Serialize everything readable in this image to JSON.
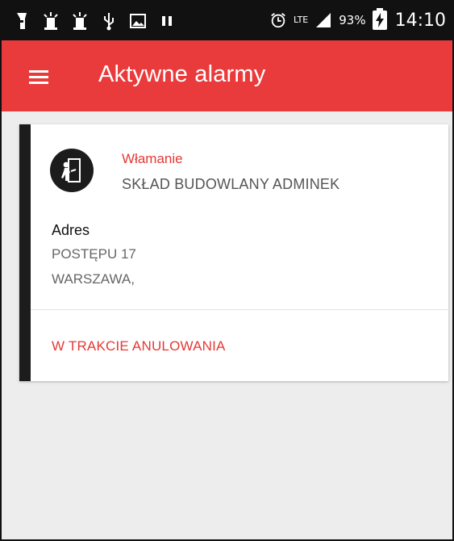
{
  "status_bar": {
    "battery_percent": "93%",
    "network": "LTE",
    "time": "14:10",
    "icons_left": [
      "flashlight-icon",
      "beacon-icon",
      "beacon-icon",
      "usb-icon",
      "image-icon",
      "pause-icon"
    ],
    "icons_right": [
      "alarm-clock-icon",
      "lte-icon",
      "signal-icon",
      "battery-charging-icon"
    ]
  },
  "app_bar": {
    "title": "Aktywne alarmy",
    "menu_icon": "hamburger-menu-icon",
    "color": "#ea3b3c"
  },
  "alarm_card": {
    "icon": "intruder-door-icon",
    "type": "Włamanie",
    "object_name": "SKŁAD BUDOWLANY ADMINEK",
    "address_label": "Adres",
    "address_line1": "POSTĘPU 17",
    "address_line2": "WARSZAWA,",
    "status": "W TRAKCIE ANULOWANIA",
    "accent_color": "#1c1c1c",
    "highlight_color": "#e53935"
  }
}
